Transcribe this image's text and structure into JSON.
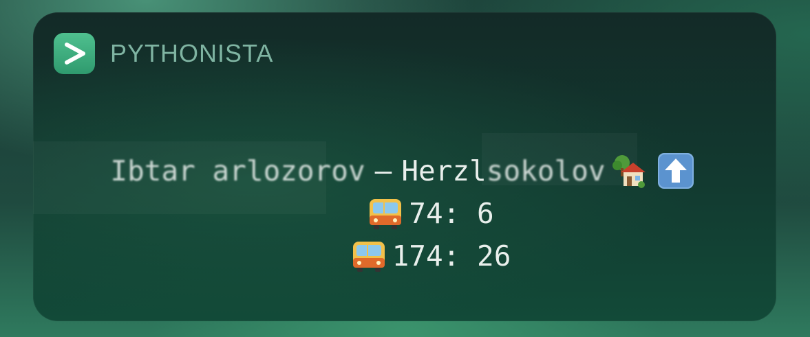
{
  "widget": {
    "app_name": "PYTHONISTA",
    "app_icon": "pythonista-chevron-icon"
  },
  "content": {
    "route_line": {
      "origin_redacted": "Ibtar arlozorov",
      "separator": "–",
      "destination_prefix": "Herzl",
      "destination_redacted": "sokolov",
      "icons": [
        "house-with-garden-icon",
        "up-arrow-icon"
      ]
    },
    "buses": [
      {
        "icon": "bus-icon",
        "route": "74",
        "minutes": "6",
        "text": "74: 6"
      },
      {
        "icon": "bus-icon",
        "route": "174",
        "minutes": "26",
        "text": "174: 26"
      }
    ]
  },
  "colors": {
    "app_icon": "#3fae7e",
    "app_name": "#7fb4a2",
    "text": "#e9efec"
  }
}
